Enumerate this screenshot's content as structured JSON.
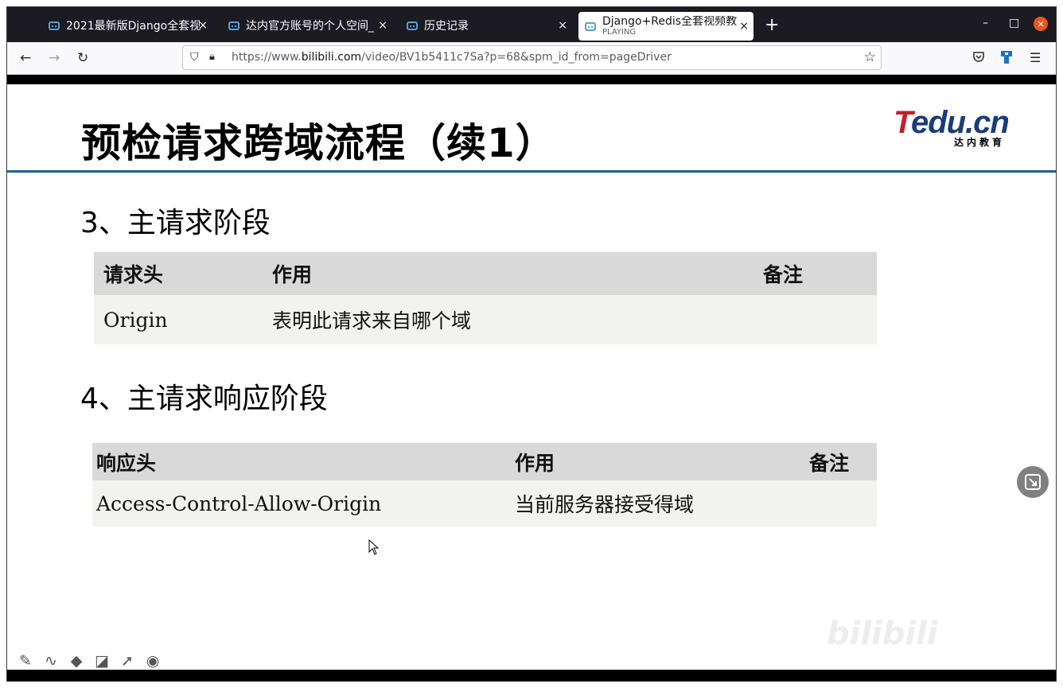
{
  "tabs": [
    {
      "title": "2021最新版Django全套视",
      "close": "×"
    },
    {
      "title": "达内官方账号的个人空间_",
      "close": "×"
    },
    {
      "title": "历史记录",
      "close": "×"
    },
    {
      "title": "Django+Redis全套视频教",
      "status": "PLAYING",
      "close": "×"
    }
  ],
  "new_tab": "+",
  "window_controls": {
    "minimize": "–",
    "maximize": "□",
    "close": "×"
  },
  "nav": {
    "back": "←",
    "forward": "→",
    "reload": "↻"
  },
  "url": {
    "prefix": "https://www.",
    "domain": "bilibili.com",
    "path": "/video/BV1b5411c7Sa?p=68&spm_id_from=pageDriver"
  },
  "toolbar_icons": [
    "pocket-icon",
    "extension-icon",
    "menu-icon"
  ],
  "slide": {
    "title": "预检请求跨域流程（续1）",
    "logo": {
      "t": "T",
      "rest": "edu.cn",
      "sub": "达内教育"
    },
    "section3": "3、主请求阶段",
    "table1": {
      "headers": [
        "请求头",
        "作用",
        "备注"
      ],
      "row": [
        "Origin",
        "表明此请求来自哪个域",
        ""
      ]
    },
    "section4": "4、主请求响应阶段",
    "table2": {
      "headers": [
        "响应头",
        "作用",
        "备注"
      ],
      "row": [
        "Access-Control-Allow-Origin",
        "当前服务器接受得域",
        ""
      ]
    }
  },
  "tool_icons": [
    "pencil-icon",
    "curve-icon",
    "fill-icon",
    "eraser-icon",
    "pointer-icon",
    "record-icon"
  ],
  "watermark": "bilibili",
  "colors": {
    "accent_blue": "#1f5f9c",
    "logo_red": "#c0212e",
    "logo_blue": "#1b3b7a",
    "close_orange": "#e95420"
  }
}
